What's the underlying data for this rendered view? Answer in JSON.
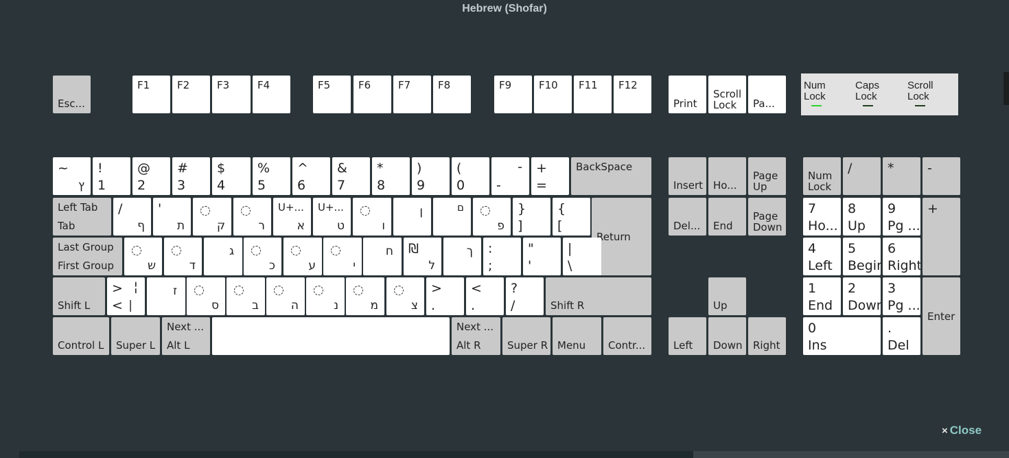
{
  "window": {
    "title": "Hebrew (Shofar)",
    "close_label": "Close",
    "close_icon": "×"
  },
  "colors": {
    "led_on": "#2fd32f",
    "led_off": "#204020",
    "background": "#2b3539"
  },
  "indicators": [
    {
      "name": "num-lock-indicator",
      "line1": "Num",
      "line2": "Lock",
      "on": true
    },
    {
      "name": "caps-lock-indicator",
      "line1": "Caps",
      "line2": "Lock",
      "on": false
    },
    {
      "name": "scroll-lock-indicator",
      "line1": "Scroll",
      "line2": "Lock",
      "on": false
    }
  ],
  "keys": [
    {
      "id": "esc",
      "bl": "Esc..."
    },
    {
      "id": "f1",
      "tl": "F1"
    },
    {
      "id": "f2",
      "tl": "F2"
    },
    {
      "id": "f3",
      "tl": "F3"
    },
    {
      "id": "f4",
      "tl": "F4"
    },
    {
      "id": "f5",
      "tl": "F5"
    },
    {
      "id": "f6",
      "tl": "F6"
    },
    {
      "id": "f7",
      "tl": "F7"
    },
    {
      "id": "f8",
      "tl": "F8"
    },
    {
      "id": "f9",
      "tl": "F9"
    },
    {
      "id": "f10",
      "tl": "F10"
    },
    {
      "id": "f11",
      "tl": "F11"
    },
    {
      "id": "f12",
      "tl": "F12"
    },
    {
      "id": "print",
      "bl": "Print"
    },
    {
      "id": "scroll-lock",
      "bl": "Scroll\nLock"
    },
    {
      "id": "pause",
      "bl": "Pa..."
    },
    {
      "id": "grave",
      "tl": "~",
      "br": "ץ"
    },
    {
      "id": "1",
      "tl": "!",
      "bl": "1"
    },
    {
      "id": "2",
      "tl": "@",
      "bl": "2"
    },
    {
      "id": "3",
      "tl": "#",
      "bl": "3"
    },
    {
      "id": "4",
      "tl": "$",
      "bl": "4"
    },
    {
      "id": "5",
      "tl": "%",
      "bl": "5"
    },
    {
      "id": "6",
      "tl": "^",
      "bl": "6"
    },
    {
      "id": "7",
      "tl": "&",
      "bl": "7"
    },
    {
      "id": "8",
      "tl": "*",
      "bl": "8"
    },
    {
      "id": "9",
      "tl": ")",
      "bl": "9"
    },
    {
      "id": "0",
      "tl": "(",
      "bl": "0"
    },
    {
      "id": "minus",
      "tr": "-",
      "bl": "-"
    },
    {
      "id": "equal",
      "tl": "+",
      "bl": "="
    },
    {
      "id": "backspace",
      "tl": "BackSpace"
    },
    {
      "id": "insert",
      "bl": "Insert"
    },
    {
      "id": "home",
      "bl": "Ho..."
    },
    {
      "id": "pgup",
      "bl": "Page\nUp"
    },
    {
      "id": "numlock",
      "bl": "Num\nLock"
    },
    {
      "id": "kp-div",
      "tl": "/"
    },
    {
      "id": "kp-mul",
      "tl": "*"
    },
    {
      "id": "kp-sub",
      "tl": "-"
    },
    {
      "id": "tab",
      "tl": "Left Tab",
      "bl": "Tab"
    },
    {
      "id": "q",
      "tl": "/",
      "br": "ף"
    },
    {
      "id": "w",
      "tl": "'",
      "br": "ת"
    },
    {
      "id": "e",
      "dot": true,
      "br": "ק"
    },
    {
      "id": "r",
      "dot": true,
      "br": "ר"
    },
    {
      "id": "t",
      "tl": "U+...",
      "br": "א"
    },
    {
      "id": "y",
      "tl": "U+...",
      "br": "ט"
    },
    {
      "id": "u",
      "dot": true,
      "br": "ו"
    },
    {
      "id": "i",
      "mr": "ן"
    },
    {
      "id": "o",
      "tr": "ם"
    },
    {
      "id": "p",
      "dot": true,
      "br": "פ"
    },
    {
      "id": "lbracket",
      "tl": "}",
      "bl": "]"
    },
    {
      "id": "rbracket",
      "tl": "{",
      "bl": "["
    },
    {
      "id": "return",
      "ml": "Return"
    },
    {
      "id": "delete",
      "bl": "Del..."
    },
    {
      "id": "end",
      "bl": "End"
    },
    {
      "id": "pgdn",
      "bl": "Page\nDown"
    },
    {
      "id": "kp7",
      "tl": "7",
      "bl": "Ho..."
    },
    {
      "id": "kp8",
      "tl": "8",
      "bl": "Up"
    },
    {
      "id": "kp9",
      "tl": "9",
      "bl": "Pg ..."
    },
    {
      "id": "kp-add",
      "tl": "+"
    },
    {
      "id": "caps",
      "tl": "Last Group",
      "bl": "First Group"
    },
    {
      "id": "a",
      "dot": true,
      "br": "ש"
    },
    {
      "id": "s",
      "dot": true,
      "br": "ד"
    },
    {
      "id": "d",
      "mr": "ג"
    },
    {
      "id": "f",
      "dot": true,
      "br": "כ"
    },
    {
      "id": "g",
      "dot": true,
      "br": "ע"
    },
    {
      "id": "h",
      "dot": true,
      "br": "י"
    },
    {
      "id": "j",
      "mr": "ח"
    },
    {
      "id": "k",
      "tl": "₪",
      "br": "ל"
    },
    {
      "id": "l",
      "mr": "ך"
    },
    {
      "id": "semicolon",
      "tl": ":",
      "bl": ";"
    },
    {
      "id": "quote",
      "tl": "\"",
      "bl": "'"
    },
    {
      "id": "backslash",
      "tl": "|",
      "bl": "\\"
    },
    {
      "id": "kp4",
      "tl": "4",
      "bl": "Left"
    },
    {
      "id": "kp5",
      "tl": "5",
      "bl": "Begin"
    },
    {
      "id": "kp6",
      "tl": "6",
      "bl": "Right"
    },
    {
      "id": "shift-l",
      "bl": "Shift L"
    },
    {
      "id": "lsgt",
      "tl": ">",
      "tr": "¦",
      "bl": "<",
      "brr": "|"
    },
    {
      "id": "z",
      "mr": "ז"
    },
    {
      "id": "x",
      "dot": true,
      "br": "ס"
    },
    {
      "id": "c",
      "dot": true,
      "br": "ב"
    },
    {
      "id": "v",
      "dot": true,
      "br": "ה"
    },
    {
      "id": "b",
      "dot": true,
      "br": "נ"
    },
    {
      "id": "n",
      "dot": true,
      "br": "מ"
    },
    {
      "id": "m",
      "dot": true,
      "br": "צ"
    },
    {
      "id": "comma",
      "tl": ">",
      "bl": "."
    },
    {
      "id": "period",
      "tl": "<",
      "bl": "."
    },
    {
      "id": "slash",
      "tl": "?",
      "bl": "/"
    },
    {
      "id": "shift-r",
      "bl": "Shift R"
    },
    {
      "id": "up",
      "bl": "Up"
    },
    {
      "id": "kp1",
      "tl": "1",
      "bl": "End"
    },
    {
      "id": "kp2",
      "tl": "2",
      "bl": "Down"
    },
    {
      "id": "kp3",
      "tl": "3",
      "bl": "Pg ..."
    },
    {
      "id": "kp-enter",
      "ml": "Enter"
    },
    {
      "id": "control-l",
      "bl": "Control L"
    },
    {
      "id": "super-l",
      "bl": "Super L"
    },
    {
      "id": "alt-l",
      "tl": "Next ...",
      "bl": "Alt L"
    },
    {
      "id": "space"
    },
    {
      "id": "alt-r",
      "tl": "Next ...",
      "bl": "Alt R"
    },
    {
      "id": "super-r",
      "bl": "Super R"
    },
    {
      "id": "menu",
      "bl": "Menu"
    },
    {
      "id": "control-r",
      "bl": "Contr..."
    },
    {
      "id": "left",
      "bl": "Left"
    },
    {
      "id": "down",
      "bl": "Down"
    },
    {
      "id": "right",
      "bl": "Right"
    },
    {
      "id": "kp0",
      "tl": "0",
      "bl": "Ins"
    },
    {
      "id": "kp-dec",
      "tl": ".",
      "bl": "Del"
    }
  ]
}
